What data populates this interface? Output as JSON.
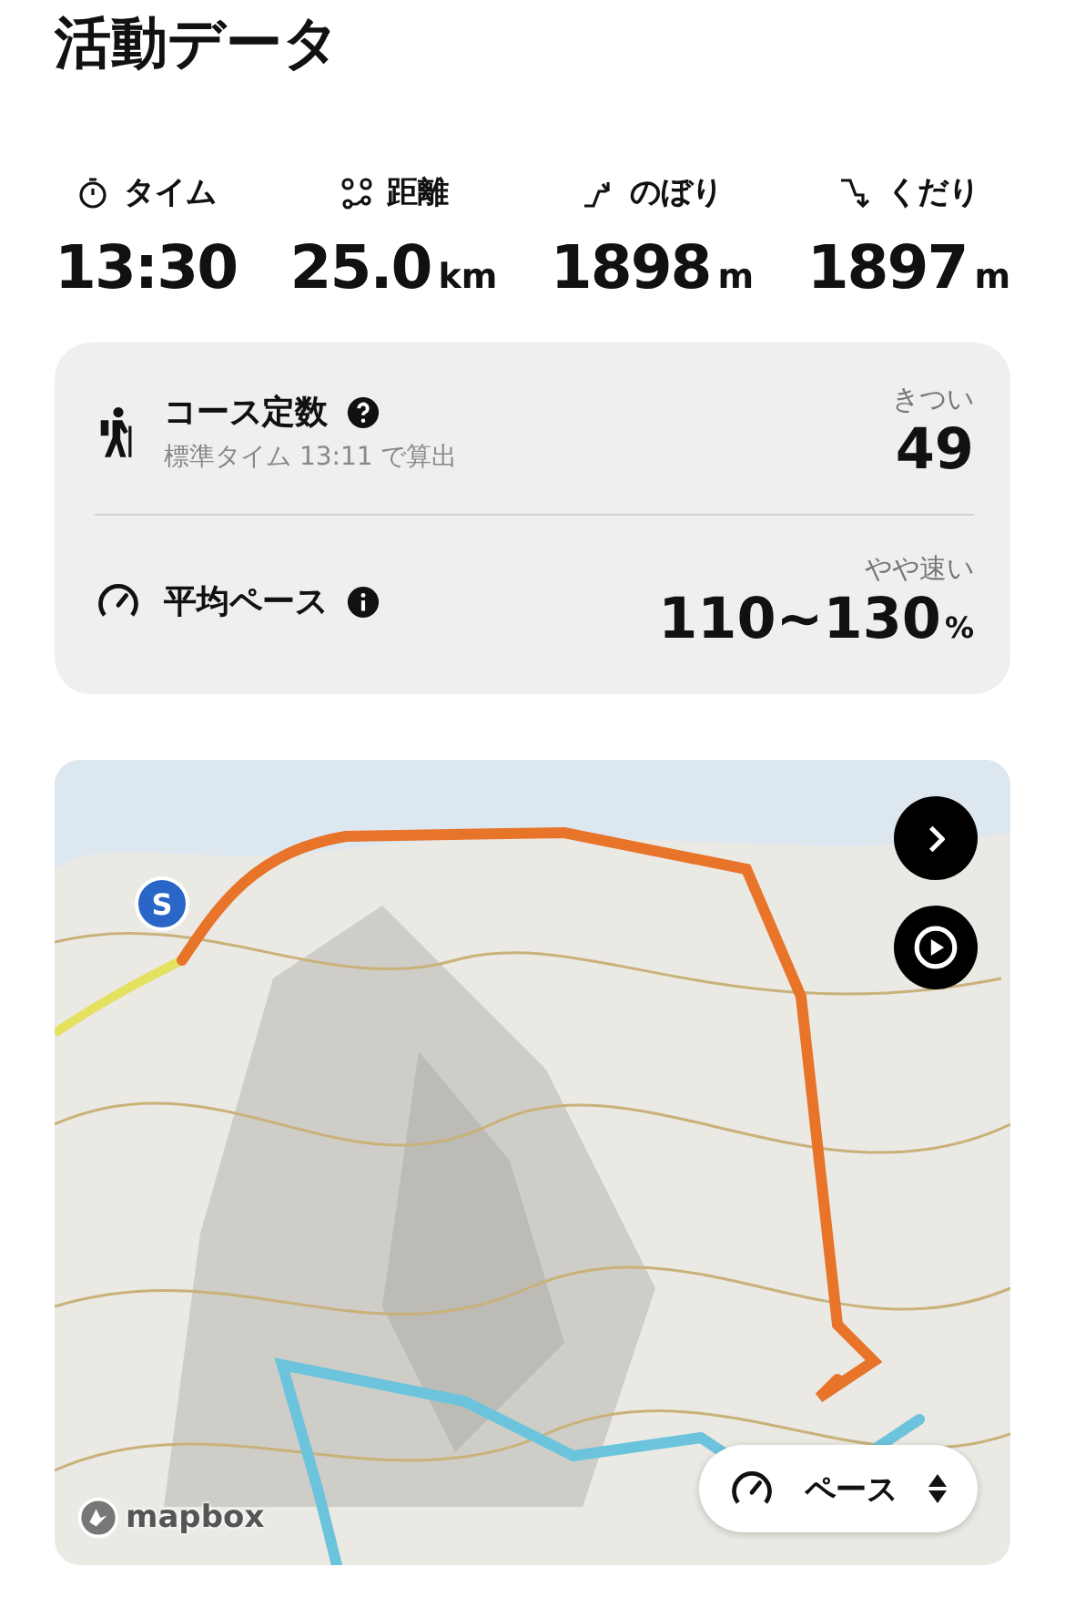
{
  "title": "活動データ",
  "stats": [
    {
      "kind": "time",
      "label": "タイム",
      "value": "13:30"
    },
    {
      "kind": "distance",
      "label": "距離",
      "value": "25.0",
      "unit": "km"
    },
    {
      "kind": "up",
      "label": "のぼり",
      "value": "1898",
      "unit": "m"
    },
    {
      "kind": "down",
      "label": "くだり",
      "value": "1897",
      "unit": "m"
    }
  ],
  "card": {
    "rows": [
      {
        "kind": "course",
        "label": "コース定数",
        "sub": "標準タイム 13:11 で算出",
        "rating": "きつい",
        "value": "49"
      },
      {
        "kind": "pace",
        "label": "平均ペース",
        "rating": "やや速い",
        "value": "110~130",
        "unit": "%"
      }
    ]
  },
  "map": {
    "kind": "picture",
    "start_marker": "S",
    "attribution": "mapbox",
    "mode_selector": "ペース"
  }
}
